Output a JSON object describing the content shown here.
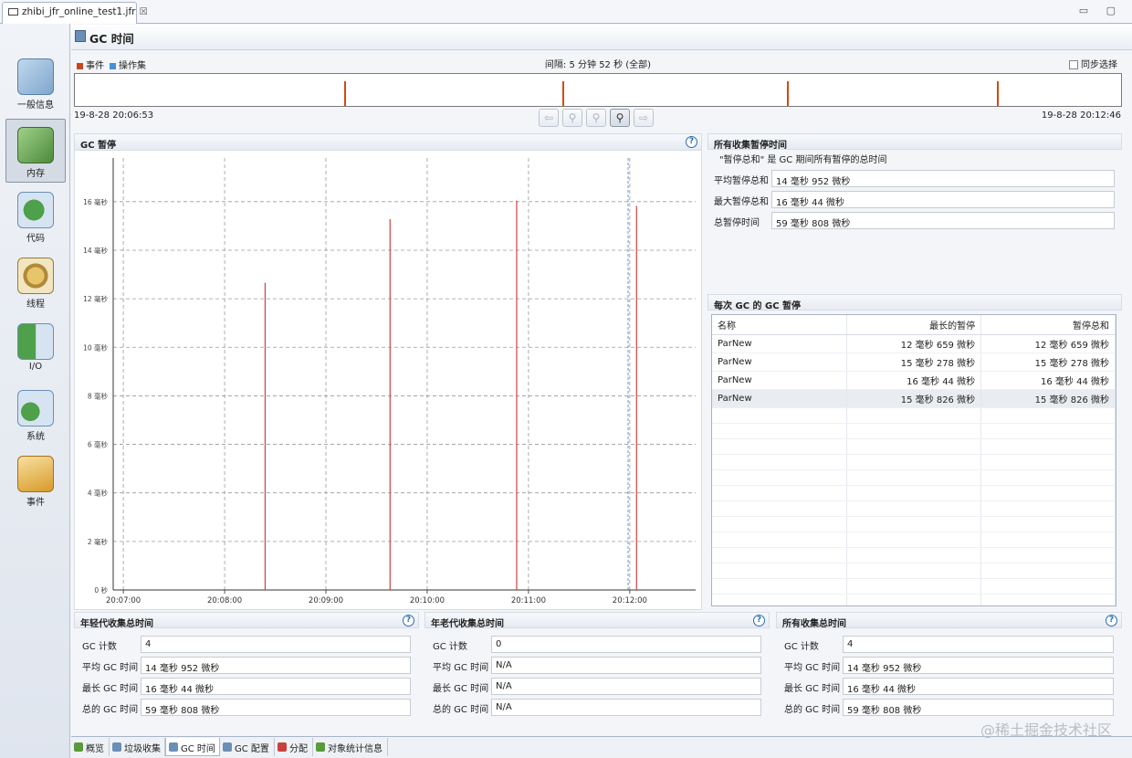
{
  "editor_tab": {
    "label": "zhibi_jfr_online_test1.jfr",
    "close": "☒"
  },
  "window_controls": "▭ ▢",
  "sidebar": {
    "items": [
      {
        "label": "一般信息",
        "icon": "gauge-chart-icon"
      },
      {
        "label": "内存",
        "icon": "memory-chip-icon",
        "selected": true
      },
      {
        "label": "代码",
        "icon": "code-java-icon"
      },
      {
        "label": "线程",
        "icon": "threads-gear-icon"
      },
      {
        "label": "I/O",
        "icon": "io-arrows-icon"
      },
      {
        "label": "系统",
        "icon": "system-server-icon"
      },
      {
        "label": "事件",
        "icon": "events-box-icon"
      }
    ]
  },
  "page": {
    "title": "GC 时间"
  },
  "timeline": {
    "legend": [
      {
        "label": "事件",
        "color": "#c8461c"
      },
      {
        "label": "操作集",
        "color": "#4a90d9"
      }
    ],
    "interval": "间隔: 5 分钟 52 秒 (全部)",
    "sync_label": "同步选择",
    "start": "19-8-28 20:06:53",
    "end": "19-8-28 20:12:46",
    "event_fractions": [
      0.257,
      0.466,
      0.681,
      0.881
    ],
    "buttons": [
      "⇦",
      "⚲",
      "⚲",
      "⚲",
      "⇨"
    ]
  },
  "gc_pause_panel": {
    "title": "GC 暂停",
    "help": "?"
  },
  "chart_data": {
    "type": "bar",
    "title": "GC 暂停",
    "x_ticks": [
      "20:07:00",
      "20:08:00",
      "20:09:00",
      "20:10:00",
      "20:11:00",
      "20:12:00"
    ],
    "y_ticks": [
      "0 秒",
      "2 毫秒",
      "4 毫秒",
      "6 毫秒",
      "8 毫秒",
      "10 毫秒",
      "12 毫秒",
      "14 毫秒",
      "16 毫秒"
    ],
    "ylim": [
      0,
      17.8
    ],
    "xlim_minutes": [
      -0.1,
      5.65
    ],
    "series": [
      {
        "times": [
          "20:08:24",
          "20:09:38",
          "20:10:53",
          "20:12:04"
        ],
        "values_ms": [
          12.659,
          15.278,
          16.044,
          15.826
        ],
        "color": "#d04040"
      }
    ],
    "cursor_time": "20:11:59",
    "grid": true
  },
  "all_pause": {
    "title": "所有收集暂停时间",
    "note": "\"暂停总和\" 是 GC 期间所有暂停的总时间",
    "rows": [
      {
        "label": "平均暂停总和",
        "value": "14 毫秒 952 微秒"
      },
      {
        "label": "最大暂停总和",
        "value": "16 毫秒 44 微秒"
      },
      {
        "label": "总暂停时间",
        "value": "59 毫秒 808 微秒"
      }
    ]
  },
  "per_gc": {
    "title": "每次 GC 的 GC 暂停",
    "columns": [
      "名称",
      "最长的暂停",
      "暂停总和"
    ],
    "rows": [
      [
        "ParNew",
        "12 毫秒 659 微秒",
        "12 毫秒 659 微秒"
      ],
      [
        "ParNew",
        "15 毫秒 278 微秒",
        "15 毫秒 278 微秒"
      ],
      [
        "ParNew",
        "16 毫秒 44 微秒",
        "16 毫秒 44 微秒"
      ],
      [
        "ParNew",
        "15 毫秒 826 微秒",
        "15 毫秒 826 微秒"
      ]
    ]
  },
  "bottom_panels": [
    {
      "title": "年轻代收集总时间",
      "rows": [
        {
          "label": "GC 计数",
          "value": "4"
        },
        {
          "label": "平均 GC 时间",
          "value": "14 毫秒 952 微秒"
        },
        {
          "label": "最长 GC 时间",
          "value": "16 毫秒 44 微秒"
        },
        {
          "label": "总的 GC 时间",
          "value": "59 毫秒 808 微秒"
        }
      ]
    },
    {
      "title": "年老代收集总时间",
      "rows": [
        {
          "label": "GC 计数",
          "value": "0"
        },
        {
          "label": "平均 GC 时间",
          "value": "N/A"
        },
        {
          "label": "最长 GC 时间",
          "value": "N/A"
        },
        {
          "label": "总的 GC 时间",
          "value": "N/A"
        }
      ]
    },
    {
      "title": "所有收集总时间",
      "rows": [
        {
          "label": "GC 计数",
          "value": "4"
        },
        {
          "label": "平均 GC 时间",
          "value": "14 毫秒 952 微秒"
        },
        {
          "label": "最长 GC 时间",
          "value": "16 毫秒 44 微秒"
        },
        {
          "label": "总的 GC 时间",
          "value": "59 毫秒 808 微秒"
        }
      ]
    }
  ],
  "bottom_tabs": [
    {
      "label": "概览",
      "color": "#5a9a3a"
    },
    {
      "label": "垃圾收集",
      "color": "#6a8fb7"
    },
    {
      "label": "GC 时间",
      "color": "#6a8fb7",
      "active": true
    },
    {
      "label": "GC 配置",
      "color": "#6a8fb7"
    },
    {
      "label": "分配",
      "color": "#c84040"
    },
    {
      "label": "对象统计信息",
      "color": "#5a9a3a"
    }
  ],
  "watermark": "@稀土掘金技术社区"
}
